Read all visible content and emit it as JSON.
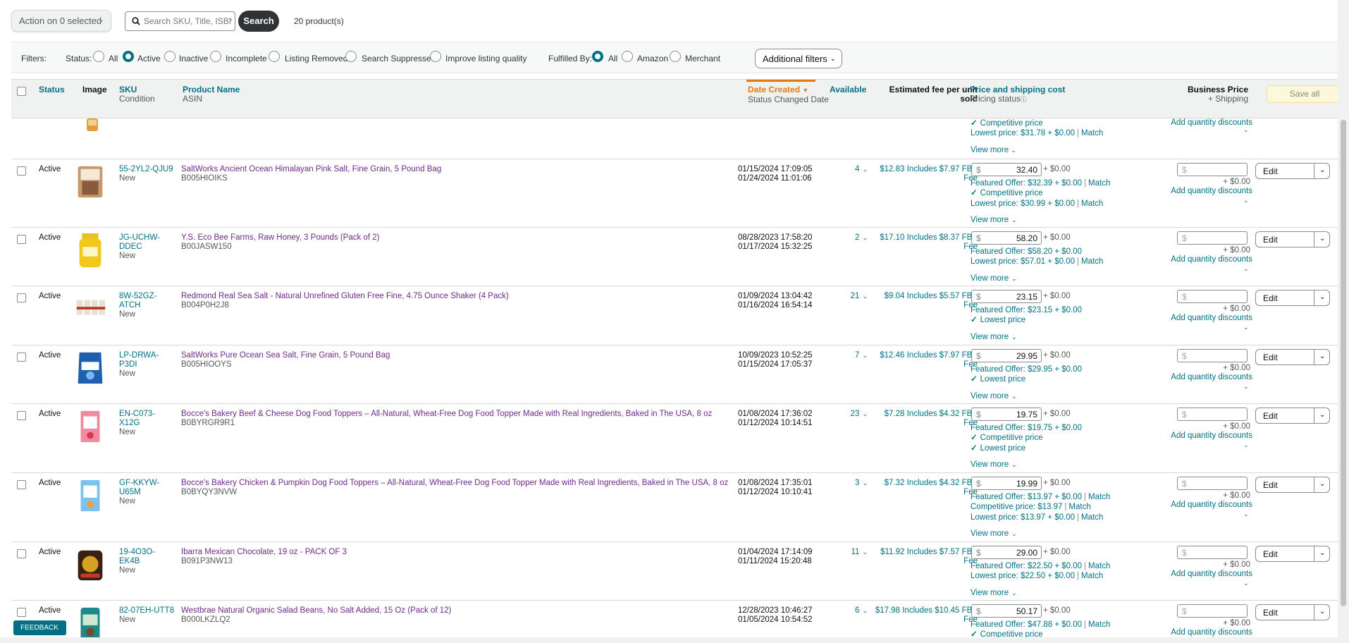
{
  "toolbar": {
    "action_label": "Action on 0 selected",
    "search_placeholder": "Search SKU, Title, ISBN",
    "search_label": "Search",
    "product_count": "20 product(s)"
  },
  "filters": {
    "label": "Filters:",
    "status_label": "Status:",
    "status_options": [
      "All",
      "Active",
      "Inactive",
      "Incomplete",
      "Listing Removed",
      "Search Suppressed",
      "Improve listing quality"
    ],
    "status_selected": "Active",
    "fulfilled_label": "Fulfilled By:",
    "fulfilled_options": [
      "All",
      "Amazon",
      "Merchant"
    ],
    "fulfilled_selected": "All",
    "additional_label": "Additional filters"
  },
  "columns": {
    "status": "Status",
    "image": "Image",
    "sku": "SKU",
    "condition": "Condition",
    "product_name": "Product Name",
    "asin": "ASIN",
    "date_created": "Date Created",
    "status_changed": "Status Changed Date",
    "available": "Available",
    "fee_line1": "Estimated fee per unit",
    "fee_line2": "sold",
    "price": "Price and shipping cost",
    "pricing_status": "Pricing status",
    "business_price": "Business Price",
    "plus_shipping": "+ Shipping",
    "save_all": "Save all"
  },
  "partial_row": {
    "offers": [
      "Competitive price",
      "Lowest price: $31.78 + $0.00",
      "Match"
    ],
    "view_more": "View more",
    "aqd": "Add quantity discounts"
  },
  "common": {
    "shipping": "+ $0.00",
    "dollar": "$",
    "view_more": "View more",
    "aqd": "Add quantity discounts",
    "edit": "Edit",
    "match": "Match",
    "feedback": "FEEDBACK"
  },
  "rows": [
    {
      "status": "Active",
      "sku": [
        "55-2YL2-QJU9"
      ],
      "condition": "New",
      "name": "SaltWorks Ancient Ocean Himalayan Pink Salt, Fine Grain, 5 Pound Bag",
      "asin": "B005HIOIKS",
      "created": "01/15/2024 17:09:05",
      "changed": "01/24/2024 11:01:06",
      "available": "4",
      "fee": "$12.83 Includes $7.97 FBA Fee",
      "price": "32.40",
      "offers": [
        {
          "text": "Featured Offer: $32.39 + $0.00",
          "match": true
        },
        {
          "text": "Competitive price",
          "check": true
        },
        {
          "text": "Lowest price: $30.99 + $0.00",
          "match": true
        }
      ]
    },
    {
      "status": "Active",
      "sku": [
        "JG-UCHW-",
        "DDEC"
      ],
      "condition": "New",
      "name": "Y.S. Eco Bee Farms, Raw Honey, 3 Pounds (Pack of 2)",
      "asin": "B00JASW150",
      "created": "08/28/2023 17:58:20",
      "changed": "01/17/2024 15:32:25",
      "available": "2",
      "fee": "$17.10 Includes $8.37 FBA Fee",
      "price": "58.20",
      "offers": [
        {
          "text": "Featured Offer: $58.20 + $0.00"
        },
        {
          "text": "Lowest price: $57.01 + $0.00",
          "match": true
        }
      ]
    },
    {
      "status": "Active",
      "sku": [
        "8W-52GZ-ATCH"
      ],
      "condition": "New",
      "name": "Redmond Real Sea Salt - Natural Unrefined Gluten Free Fine, 4.75 Ounce Shaker (4 Pack)",
      "asin": "B004P0H2J8",
      "created": "01/09/2024 13:04:42",
      "changed": "01/16/2024 16:54:14",
      "available": "21",
      "fee": "$9.04 Includes $5.57 FBA Fee",
      "price": "23.15",
      "offers": [
        {
          "text": "Featured Offer: $23.15 + $0.00"
        },
        {
          "text": "Lowest price",
          "check": true
        }
      ]
    },
    {
      "status": "Active",
      "sku": [
        "LP-DRWA-P3DI"
      ],
      "condition": "New",
      "name": "SaltWorks Pure Ocean Sea Salt, Fine Grain, 5 Pound Bag",
      "asin": "B005HIOOYS",
      "created": "10/09/2023 10:52:25",
      "changed": "01/15/2024 17:05:37",
      "available": "7",
      "fee": "$12.46 Includes $7.97 FBA Fee",
      "price": "29.95",
      "offers": [
        {
          "text": "Featured Offer: $29.95 + $0.00"
        },
        {
          "text": "Lowest price",
          "check": true
        }
      ]
    },
    {
      "status": "Active",
      "sku": [
        "EN-C073-X12G"
      ],
      "condition": "New",
      "name": "Bocce's Bakery Beef & Cheese Dog Food Toppers – All-Natural, Wheat-Free Dog Food Topper Made with Real Ingredients, Baked in The USA, 8 oz",
      "asin": "B0BYRGR9R1",
      "created": "01/08/2024 17:36:02",
      "changed": "01/12/2024 10:14:51",
      "available": "23",
      "fee": "$7.28 Includes $4.32 FBA Fee",
      "price": "19.75",
      "offers": [
        {
          "text": "Featured Offer: $19.75 + $0.00"
        },
        {
          "text": "Competitive price",
          "check": true
        },
        {
          "text": "Lowest price",
          "check": true
        }
      ]
    },
    {
      "status": "Active",
      "sku": [
        "GF-KKYW-",
        "U65M"
      ],
      "condition": "New",
      "name": "Bocce's Bakery Chicken & Pumpkin Dog Food Toppers – All-Natural, Wheat-Free Dog Food Topper Made with Real Ingredients, Baked in The USA, 8 oz",
      "asin": "B0BYQY3NVW",
      "created": "01/08/2024 17:35:01",
      "changed": "01/12/2024 10:10:41",
      "available": "3",
      "fee": "$7.32 Includes $4.32 FBA Fee",
      "price": "19.99",
      "offers": [
        {
          "text": "Featured Offer: $13.97 + $0.00",
          "match": true
        },
        {
          "text": "Competitive price: $13.97",
          "match": true
        },
        {
          "text": "Lowest price: $13.97 + $0.00",
          "match": true
        }
      ]
    },
    {
      "status": "Active",
      "sku": [
        "19-4O3O-EK4B"
      ],
      "condition": "New",
      "name": "Ibarra Mexican Chocolate, 19 oz - PACK OF 3",
      "asin": "B091P3NW13",
      "created": "01/04/2024 17:14:09",
      "changed": "01/11/2024 15:20:48",
      "available": "11",
      "fee": "$11.92 Includes $7.57 FBA Fee",
      "price": "29.00",
      "offers": [
        {
          "text": "Featured Offer: $22.50 + $0.00",
          "match": true
        },
        {
          "text": "Lowest price: $22.50 + $0.00",
          "match": true
        }
      ]
    },
    {
      "status": "Active",
      "sku": [
        "82-07EH-UTT8"
      ],
      "condition": "New",
      "name": "Westbrae Natural Organic Salad Beans, No Salt Added, 15 Oz (Pack of 12)",
      "asin": "B000LKZLQ2",
      "created": "12/28/2023 10:46:27",
      "changed": "01/05/2024 10:54:52",
      "available": "6",
      "fee": "$17.98 Includes $10.45 FBA Fee",
      "price": "50.17",
      "offers": [
        {
          "text": "Featured Offer: $47.88 + $0.00",
          "match": true
        },
        {
          "text": "Competitive price",
          "check": true
        }
      ]
    }
  ]
}
